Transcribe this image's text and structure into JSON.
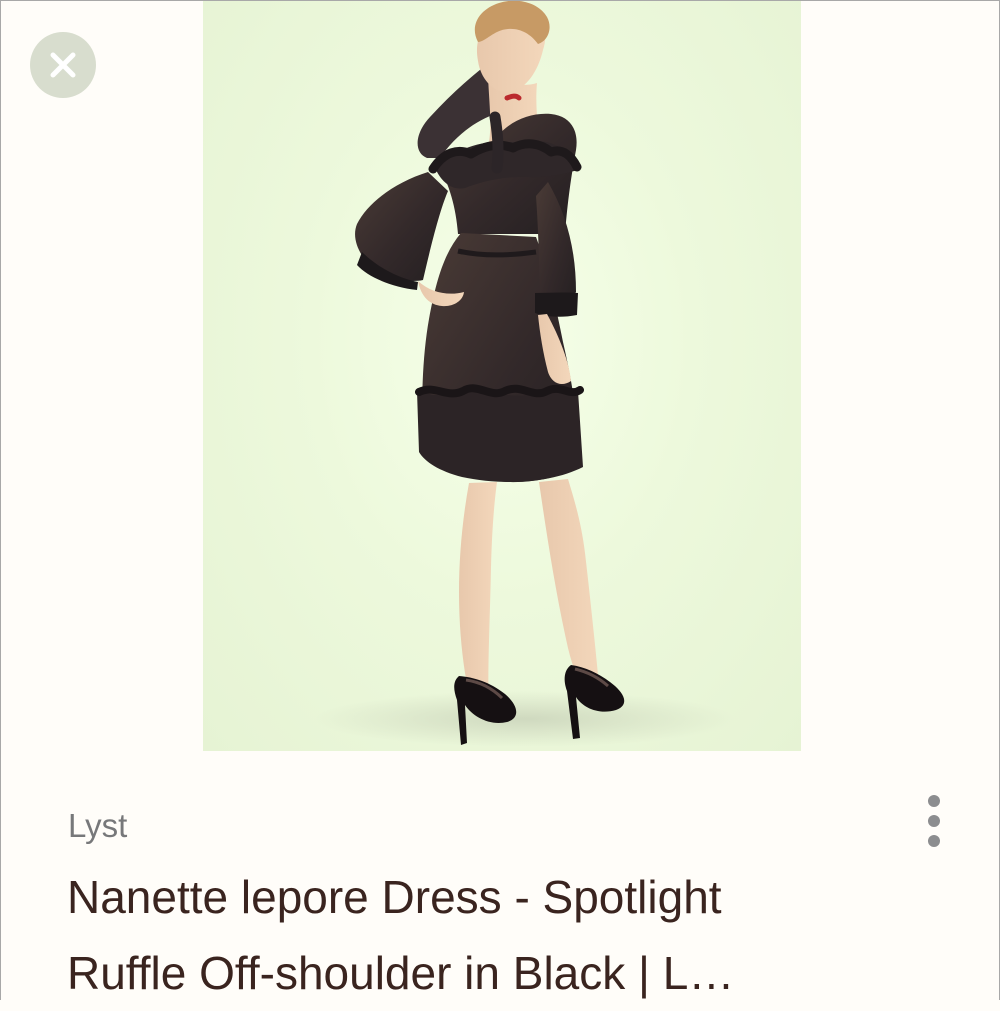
{
  "result": {
    "source": "Lyst",
    "title_lines": [
      "Nanette lepore Dress - Spotlight",
      "Ruffle Off-shoulder in Black | L…"
    ]
  },
  "icons": {
    "close": "close-icon",
    "more": "more-vertical-icon"
  },
  "colors": {
    "image_background": "#edf9dc",
    "source_text": "#77787a",
    "title_text": "#3a241f",
    "close_button": "#d8ddce"
  }
}
